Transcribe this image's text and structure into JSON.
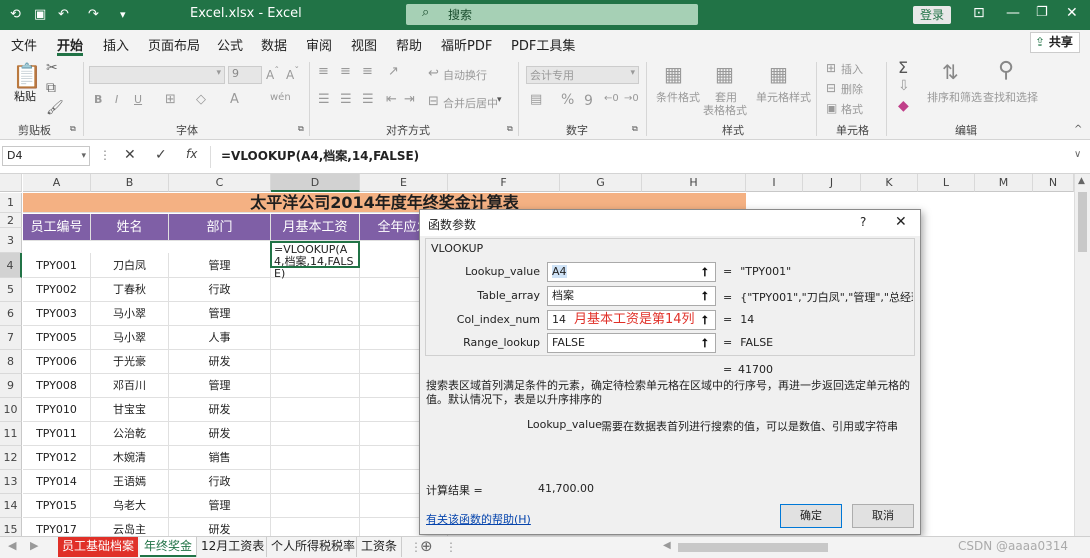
{
  "titlebar": {
    "title": "Excel.xlsx  -  Excel",
    "search_placeholder": "搜索",
    "login": "登录"
  },
  "menu": [
    "文件",
    "开始",
    "插入",
    "页面布局",
    "公式",
    "数据",
    "审阅",
    "视图",
    "帮助",
    "福昕PDF",
    "PDF工具集"
  ],
  "share": "共享",
  "ribbon": {
    "paste": "粘贴",
    "clipboard": "剪贴板",
    "font": "字体",
    "align": "对齐方式",
    "wrap": "自动换行",
    "merge": "合并后居中",
    "numfmt": "会计专用",
    "number": "数字",
    "cond": "条件格式",
    "table1": "套用",
    "table2": "表格格式",
    "cellstyle": "单元格样式",
    "style": "样式",
    "insert": "插入",
    "delete": "删除",
    "format": "格式",
    "cells": "单元格",
    "sortfilter": "排序和筛选",
    "findsel": "查找和选择",
    "edit": "编辑",
    "fontsize": "9"
  },
  "formulabar": {
    "namebox": "D4",
    "fx": "fx",
    "formula": "=VLOOKUP(A4,档案,14,FALSE)"
  },
  "columns": [
    "A",
    "B",
    "C",
    "D",
    "E",
    "F",
    "G",
    "H",
    "I",
    "J",
    "K",
    "L",
    "M",
    "N"
  ],
  "rows": [
    "1",
    "2",
    "3",
    "4",
    "5",
    "6",
    "7",
    "8",
    "9",
    "10",
    "11",
    "12",
    "13",
    "14",
    "15"
  ],
  "sheet": {
    "title": "太平洋公司2014年度年终奖金计算表",
    "headers": [
      "员工编号",
      "姓名",
      "部门",
      "月基本工资",
      "全年应发"
    ],
    "edit_cell": "=VLOOKUP(A4,档案,14,FALSE)",
    "data": [
      [
        "TPY001",
        "刀白凤",
        "管理"
      ],
      [
        "TPY002",
        "丁春秋",
        "行政"
      ],
      [
        "TPY003",
        "马小翠",
        "管理"
      ],
      [
        "TPY005",
        "马小翠",
        "人事"
      ],
      [
        "TPY006",
        "于光豪",
        "研发"
      ],
      [
        "TPY008",
        "邓百川",
        "管理"
      ],
      [
        "TPY010",
        "甘宝宝",
        "研发"
      ],
      [
        "TPY011",
        "公治乾",
        "研发"
      ],
      [
        "TPY012",
        "木婉清",
        "销售"
      ],
      [
        "TPY014",
        "王语嫣",
        "行政"
      ],
      [
        "TPY015",
        "乌老大",
        "管理"
      ],
      [
        "TPY017",
        "云岛主",
        "研发"
      ]
    ]
  },
  "tabs": [
    "员工基础档案",
    "年终奖金",
    "12月工资表",
    "个人所得税税率",
    "工资条"
  ],
  "dialog": {
    "title": "函数参数",
    "help": "?",
    "close": "✕",
    "func": "VLOOKUP",
    "args": [
      {
        "label": "Lookup_value",
        "value": "A4",
        "result": "\"TPY001\""
      },
      {
        "label": "Table_array",
        "value": "档案",
        "result": "{\"TPY001\",\"刀白凤\",\"管理\",\"总经理..."
      },
      {
        "label": "Col_index_num",
        "value": "14",
        "note": "月基本工资是第14列",
        "result": "14"
      },
      {
        "label": "Range_lookup",
        "value": "FALSE",
        "result": "FALSE"
      }
    ],
    "eq": "=",
    "total": "41700",
    "desc": "搜索表区域首列满足条件的元素，确定待检索单元格在区域中的行序号，再进一步返回选定单元格的值。默认情况下，表是以升序排序的",
    "argname": "Lookup_value",
    "argdesc": "需要在数据表首列进行搜索的值，可以是数值、引用或字符串",
    "result_label": "计算结果 =",
    "result_value": "41,700.00",
    "help_link": "有关该函数的帮助(H)",
    "ok": "确定",
    "cancel": "取消"
  },
  "watermark": "CSDN @aaaa0314"
}
